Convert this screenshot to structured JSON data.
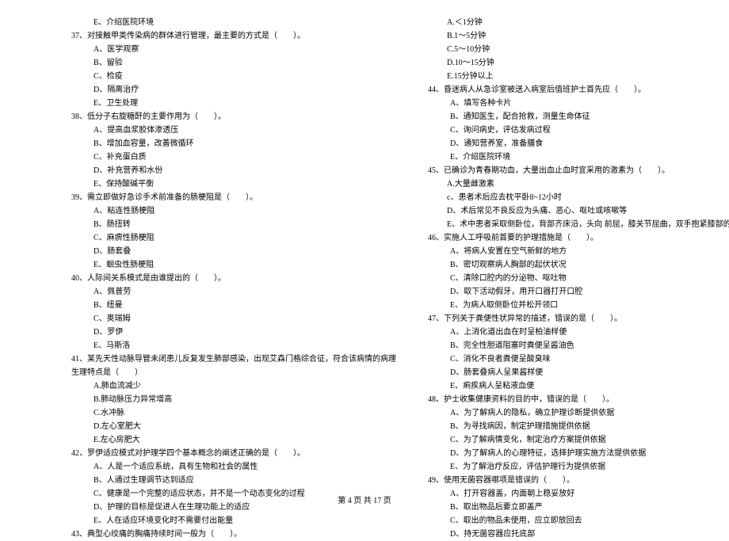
{
  "footer": "第 4 页 共 17 页",
  "left_column": [
    {
      "type": "opt",
      "text": "E、介绍医院环境"
    },
    {
      "type": "q",
      "text": "37、对接触甲类传染病的群体进行管理，最主要的方式是（　　）。"
    },
    {
      "type": "opt",
      "text": "A、医学观察"
    },
    {
      "type": "opt",
      "text": "B、留验"
    },
    {
      "type": "opt",
      "text": "C、检疫"
    },
    {
      "type": "opt",
      "text": "D、隔离治疗"
    },
    {
      "type": "opt",
      "text": "E、卫生处理"
    },
    {
      "type": "q",
      "text": "38、低分子右旋糖酐的主要作用为（　　）。"
    },
    {
      "type": "opt",
      "text": "A、提高血浆胶体渗透压"
    },
    {
      "type": "opt",
      "text": "B、增加血容量，改善微循环"
    },
    {
      "type": "opt",
      "text": "C、补充蛋白质"
    },
    {
      "type": "opt",
      "text": "D、补充营养和水份"
    },
    {
      "type": "opt",
      "text": "E、保持酸碱平衡"
    },
    {
      "type": "q",
      "text": "39、需立即做好急诊手术前准备的肠梗阻是（　　）。"
    },
    {
      "type": "opt",
      "text": "A、粘连性肠梗阻"
    },
    {
      "type": "opt",
      "text": "B、肠扭转"
    },
    {
      "type": "opt",
      "text": "C、麻痹性肠梗阻"
    },
    {
      "type": "opt",
      "text": "D、肠套叠"
    },
    {
      "type": "opt",
      "text": "E、蛔虫性肠梗阻"
    },
    {
      "type": "q",
      "text": "40、人际间关系模式是由谁提出的（　　）。"
    },
    {
      "type": "opt",
      "text": "A、佩普劳"
    },
    {
      "type": "opt",
      "text": "B、纽曼"
    },
    {
      "type": "opt",
      "text": "C、奥瑞姆"
    },
    {
      "type": "opt",
      "text": "D、罗伊"
    },
    {
      "type": "opt",
      "text": "E、马斯洛"
    },
    {
      "type": "q",
      "text": "41、某先天性动脉导管未闭患儿反复发生肺部感染，出现艾森门格综合征，符合该病情的病理"
    },
    {
      "type": "cont",
      "text": "生理特点是（　　）"
    },
    {
      "type": "opt",
      "text": "A.肺血流减少"
    },
    {
      "type": "opt",
      "text": "B.肺动脉压力异常增高"
    },
    {
      "type": "opt",
      "text": "C.水冲脉"
    },
    {
      "type": "opt",
      "text": "D.左心室肥大"
    },
    {
      "type": "opt",
      "text": "E.左心房肥大"
    },
    {
      "type": "q",
      "text": "42、罗伊适应模式对护理学四个基本概念的阐述正确的是（　　）。"
    },
    {
      "type": "opt",
      "text": "A、人是一个适应系统，具有生物和社会的属性"
    },
    {
      "type": "opt",
      "text": "B、人通过生理调节达到适应"
    },
    {
      "type": "opt",
      "text": "C、健康是一个完整的适应状态，并不是一个动态变化的过程"
    },
    {
      "type": "opt",
      "text": "D、护理的目标是促进人在生理功能上的适应"
    },
    {
      "type": "opt",
      "text": "E、人在适应环境变化时不需要付出能量"
    },
    {
      "type": "q",
      "text": "43、典型心绞痛的胸痛持续时间一般为（　　）。"
    }
  ],
  "right_column": [
    {
      "type": "optb",
      "text": "A.＜1分钟"
    },
    {
      "type": "optb",
      "text": "B.1～5分钟"
    },
    {
      "type": "optb",
      "text": "C.5～10分钟"
    },
    {
      "type": "optb",
      "text": "D.10～15分钟"
    },
    {
      "type": "optb",
      "text": "E.15分钟以上"
    },
    {
      "type": "q",
      "text": "44、昏迷病人从急诊室被送入病室后值班护士首先应（　　）。"
    },
    {
      "type": "opt",
      "text": "A、填写各种卡片"
    },
    {
      "type": "opt",
      "text": "B、通知医生，配合抢救，测量生命体征"
    },
    {
      "type": "opt",
      "text": "C、询问病史，评估发病过程"
    },
    {
      "type": "opt",
      "text": "D、通知营养室，准备膳食"
    },
    {
      "type": "opt",
      "text": "E、介绍医院环境"
    },
    {
      "type": "q",
      "text": "45、已确诊为青春期功血，大量出血止血时宜采用的激素为（　　）。"
    },
    {
      "type": "optb",
      "text": "A.大量雌激素"
    },
    {
      "type": "optb",
      "text": "c、患者术后应去枕平卧8~12小时"
    },
    {
      "type": "optb",
      "text": "D、术后常见不良反应为头痛、恶心、呕吐或咳嗽等"
    },
    {
      "type": "optb",
      "text": "E、术中患者采取侧卧位，背部齐床沿，头向 前屈，膝关节屈曲，双手抱紧膝部的姿势"
    },
    {
      "type": "q",
      "text": "46、实施人工呼吸前首要的护理措施是（　　）。"
    },
    {
      "type": "opt",
      "text": "A、将病人安置在空气新鲜的地方"
    },
    {
      "type": "opt",
      "text": "B、密切观察病人胸部的起伏状况"
    },
    {
      "type": "opt",
      "text": "C、清除口腔内的分泌物、呕吐物"
    },
    {
      "type": "opt",
      "text": "D、取下活动假牙，用开口器打开口腔"
    },
    {
      "type": "opt",
      "text": "E、为病人取侧卧位并松开领口"
    },
    {
      "type": "q",
      "text": "47、下列关于粪便性状异常的描述，错误的是（　　）。"
    },
    {
      "type": "opt",
      "text": "A、上消化道出血在时呈柏油样便"
    },
    {
      "type": "opt",
      "text": "B、完全性胆道阻塞时粪便呈酱油色"
    },
    {
      "type": "opt",
      "text": "C、消化不良者粪便呈酸臭味"
    },
    {
      "type": "opt",
      "text": "D、肠套叠病人呈果酱样便"
    },
    {
      "type": "opt",
      "text": "E、痢疾病人呈粘液血便"
    },
    {
      "type": "q",
      "text": "48、护士收集健康资料的目的中，错误的是（　　）。"
    },
    {
      "type": "opt",
      "text": "A、为了解病人的隐私，确立护理诊断提供依据"
    },
    {
      "type": "opt",
      "text": "B、为寻找病因，制定护理措施提供依据"
    },
    {
      "type": "opt",
      "text": "C、为了解病情变化，制定治疗方案提供依据"
    },
    {
      "type": "opt",
      "text": "D、为了解病人的心理特征，选择护理实施方法提供依据"
    },
    {
      "type": "opt",
      "text": "E、为了解治疗反应，评估护理行为提供依据"
    },
    {
      "type": "q",
      "text": "49、使用无菌容器哪项是错误的（　　）。"
    },
    {
      "type": "opt",
      "text": "A、打开容器盖，内面朝上稳妥放好"
    },
    {
      "type": "opt",
      "text": "B、取出物品后要立即盖严"
    },
    {
      "type": "opt",
      "text": "C、取出的物品未使用，应立即放回去"
    },
    {
      "type": "opt",
      "text": "D、持无菌容器应托底部"
    }
  ]
}
